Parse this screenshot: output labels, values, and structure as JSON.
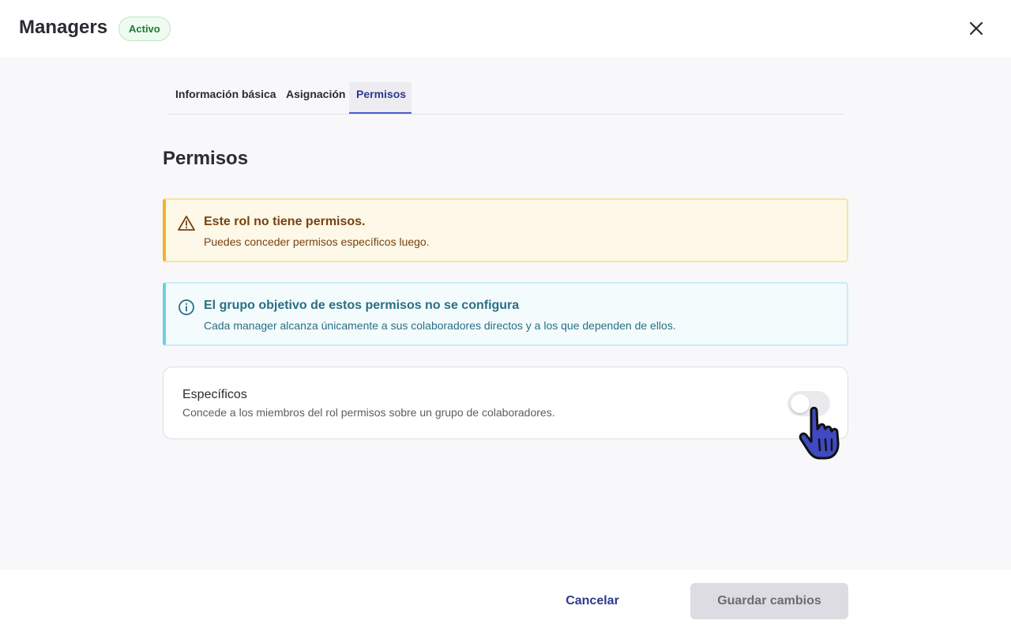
{
  "header": {
    "title": "Managers",
    "status": "Activo",
    "close_icon": "close-icon"
  },
  "tabs": [
    {
      "label": "Información básica",
      "active": false
    },
    {
      "label": "Asignación",
      "active": false
    },
    {
      "label": "Permisos",
      "active": true
    }
  ],
  "section": {
    "title": "Permisos"
  },
  "alerts": {
    "warning": {
      "icon": "warning-triangle-icon",
      "title": "Este rol no tiene permisos.",
      "text": "Puedes conceder permisos específicos luego."
    },
    "info": {
      "icon": "info-circle-icon",
      "title": "El grupo objetivo de estos permisos no se configura",
      "text": "Cada manager alcanza únicamente a sus colaboradores directos y a los que dependen de ellos."
    }
  },
  "specific_permissions": {
    "title": "Específicos",
    "description": "Concede a los miembros del rol permisos sobre un grupo de colaboradores.",
    "enabled": false
  },
  "footer": {
    "cancel_label": "Cancelar",
    "save_label": "Guardar cambios"
  },
  "colors": {
    "accent": "#2d3a8c",
    "tab_underline": "#4b5bd0",
    "warning_border": "#f0b429",
    "info_border": "#6fcde3",
    "badge_green": "#1e7a34"
  }
}
